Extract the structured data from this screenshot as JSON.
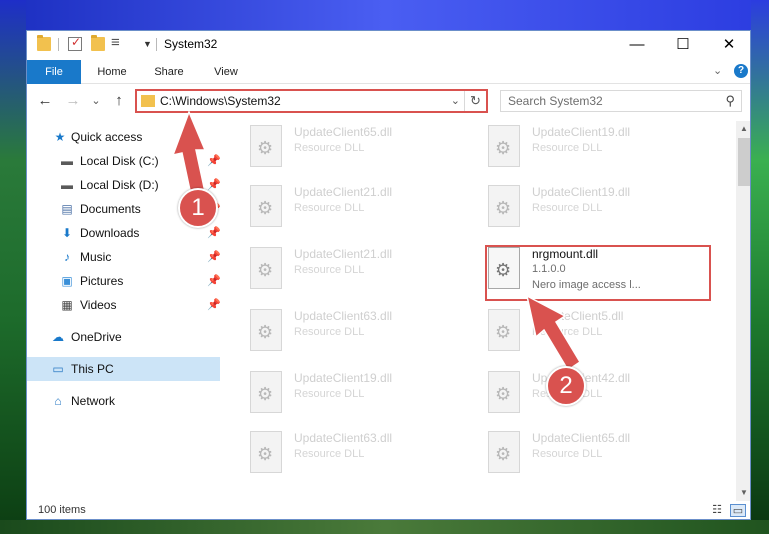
{
  "window": {
    "title": "System32",
    "caption": {
      "minimize": "—",
      "maximize": "☐",
      "close": "✕"
    }
  },
  "ribbon": {
    "tabs": [
      {
        "label": "File"
      },
      {
        "label": "Home"
      },
      {
        "label": "Share"
      },
      {
        "label": "View"
      }
    ],
    "expand_glyph": "⌄",
    "help_glyph": "?"
  },
  "nav": {
    "back": "←",
    "forward": "→",
    "recent": "⌄",
    "up": "↑",
    "address": "C:\\Windows\\System32",
    "address_dropdown": "⌄",
    "refresh": "↻",
    "search_placeholder": "Search System32",
    "search_glyph": "⚲"
  },
  "sidebar": {
    "pin_glyph": "📌",
    "items": [
      {
        "label": "Quick access",
        "icon": "star-icon",
        "glyph": "★",
        "color": "#1979ca"
      },
      {
        "label": "Local Disk (C:)",
        "icon": "drive-icon",
        "glyph": "▬",
        "color": "#5a5a5a"
      },
      {
        "label": "Local Disk (D:)",
        "icon": "drive-icon",
        "glyph": "▬",
        "color": "#5a5a5a"
      },
      {
        "label": "Documents",
        "icon": "documents-icon",
        "glyph": "▤",
        "color": "#4a6fa5"
      },
      {
        "label": "Downloads",
        "icon": "download-icon",
        "glyph": "⬇",
        "color": "#1979ca"
      },
      {
        "label": "Music",
        "icon": "music-icon",
        "glyph": "♪",
        "color": "#1979ca"
      },
      {
        "label": "Pictures",
        "icon": "pictures-icon",
        "glyph": "▣",
        "color": "#3a8fd8"
      },
      {
        "label": "Videos",
        "icon": "video-icon",
        "glyph": "▦",
        "color": "#444444"
      },
      {
        "label": "OneDrive",
        "icon": "cloud-icon",
        "glyph": "☁",
        "color": "#1979ca"
      },
      {
        "label": "This PC",
        "icon": "computer-icon",
        "glyph": "▭",
        "color": "#2a7ac4"
      },
      {
        "label": "Network",
        "icon": "network-icon",
        "glyph": "⌂",
        "color": "#2a7ac4"
      }
    ]
  },
  "files": [
    {
      "name": "UpdateClient65.dll",
      "type": "Resource DLL"
    },
    {
      "name": "UpdateClient19.dll",
      "type": "Resource DLL"
    },
    {
      "name": "UpdateClient21.dll",
      "type": "Resource DLL"
    },
    {
      "name": "UpdateClient19.dll",
      "type": "Resource DLL"
    },
    {
      "name": "UpdateClient21.dll",
      "type": "Resource DLL"
    },
    {
      "name": "nrgmount.dll",
      "version": "1.1.0.0",
      "description": "Nero image access l..."
    },
    {
      "name": "UpdateClient63.dll",
      "type": "Resource DLL"
    },
    {
      "name": "UpdateClient5.dll",
      "type": "Resource DLL"
    },
    {
      "name": "UpdateClient19.dll",
      "type": "Resource DLL"
    },
    {
      "name": "UpdateClient42.dll",
      "type": "Resource DLL"
    },
    {
      "name": "UpdateClient63.dll",
      "type": "Resource DLL"
    },
    {
      "name": "UpdateClient65.dll",
      "type": "Resource DLL"
    }
  ],
  "status": {
    "count": "100 items"
  },
  "annotations": {
    "callout_1": "1",
    "callout_2": "2",
    "accent": "#d9524f"
  }
}
